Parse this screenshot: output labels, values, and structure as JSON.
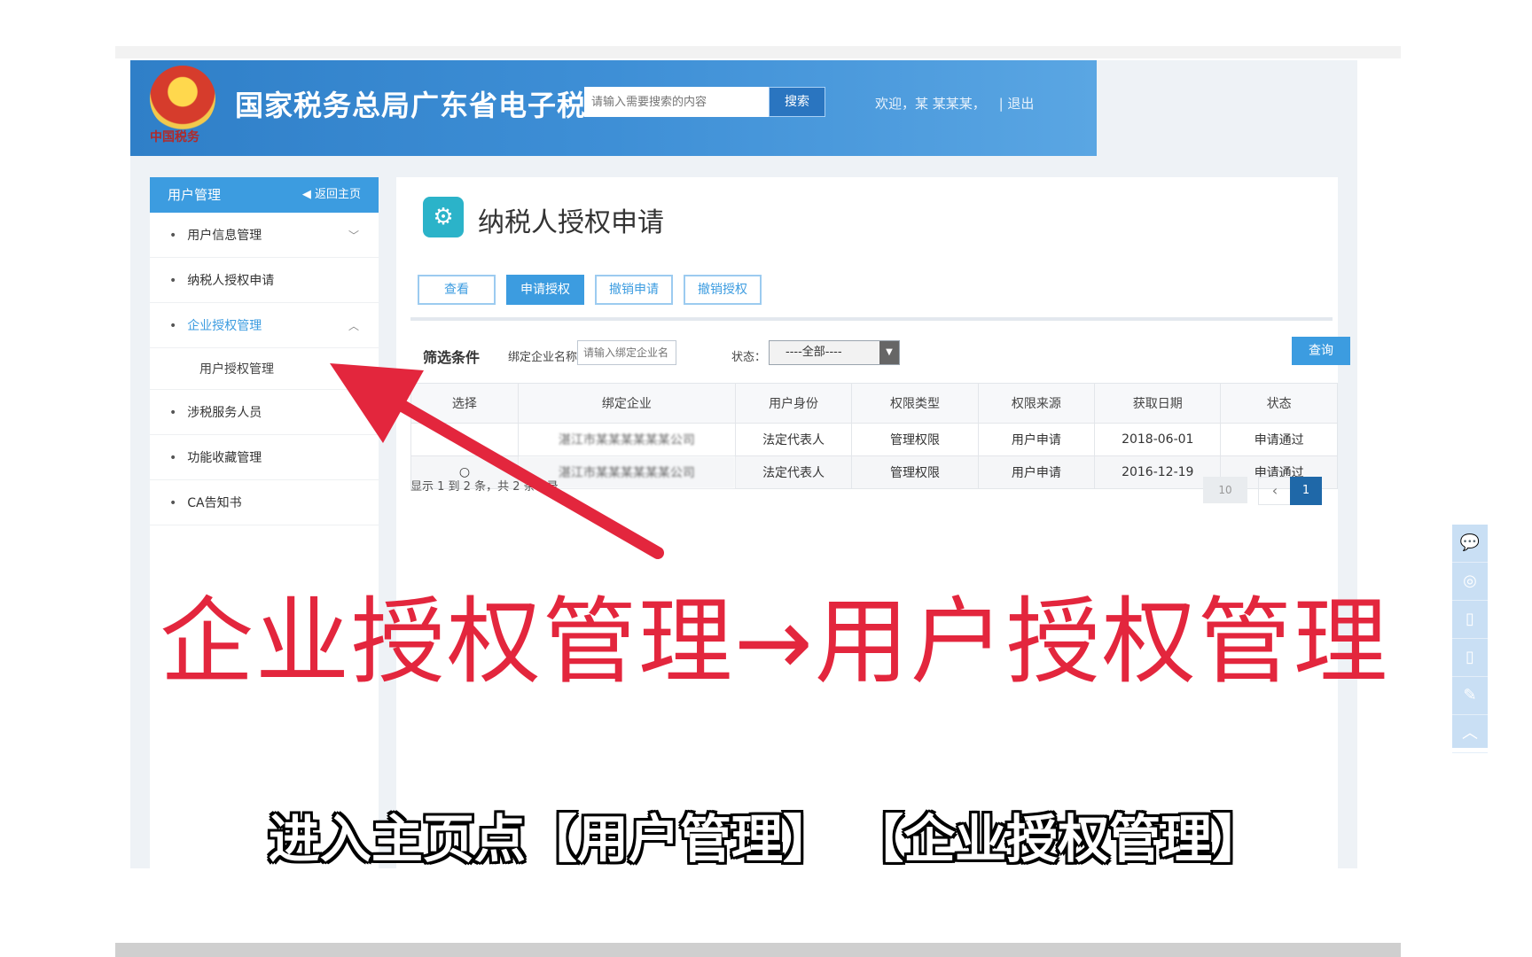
{
  "header": {
    "emblem_subtext": "中国税务",
    "site_title": "国家税务总局广东省电子税",
    "search_placeholder": "请输入需要搜索的内容",
    "search_button": "搜索",
    "welcome": "欢迎，某 某某某，",
    "logout": "| 退出",
    "colors": {
      "header_start": "#2f7fc8",
      "header_end": "#5aa6e3"
    }
  },
  "sidebar": {
    "title": "用户管理",
    "back_home": "◀ 返回主页",
    "items": [
      {
        "label": "用户信息管理",
        "chevron": "﹀"
      },
      {
        "label": "纳税人授权申请",
        "chevron": ""
      },
      {
        "label": "企业授权管理",
        "chevron": "︿"
      },
      {
        "label": "涉税服务人员",
        "chevron": ""
      },
      {
        "label": "功能收藏管理",
        "chevron": ""
      },
      {
        "label": "CA告知书",
        "chevron": ""
      }
    ],
    "sub_item": "用户授权管理"
  },
  "main": {
    "page_icon": "⚙",
    "page_title": "纳税人授权申请",
    "tabs": [
      "查看",
      "申请授权",
      "撤销申请",
      "撤销授权"
    ],
    "filter": {
      "label": "筛选条件",
      "company_label": "绑定企业名称：",
      "company_placeholder": "请输入绑定企业名",
      "status_label": "状态：",
      "status_value": "----全部----",
      "query_button": "查询"
    },
    "table": {
      "columns": [
        "选择",
        "绑定企业",
        "用户身份",
        "权限类型",
        "权限来源",
        "获取日期",
        "状态"
      ],
      "rows": [
        {
          "select": "",
          "company": "湛江市某某某某某某公司",
          "identity": "法定代表人",
          "type": "管理权限",
          "source": "用户申请",
          "date": "2018-06-01",
          "status": "申请通过"
        },
        {
          "select": "○",
          "company": "湛江市某某某某某某公司",
          "identity": "法定代表人",
          "type": "管理权限",
          "source": "用户申请",
          "date": "2016-12-19",
          "status": "申请通过"
        }
      ]
    },
    "pager": {
      "summary": "显示 1 到 2 条，共 2 条记录",
      "page_size": "10",
      "prev": "‹",
      "current_page": "1"
    }
  },
  "float_toolbar": [
    "💬",
    "◎",
    "▯",
    "▯",
    "✎",
    "︿"
  ],
  "overlay": {
    "caption": "企业授权管理→用户授权管理",
    "subtitle": "进入主页点【用户管理】 【企业授权管理】",
    "accent_color": "#e3263d"
  }
}
